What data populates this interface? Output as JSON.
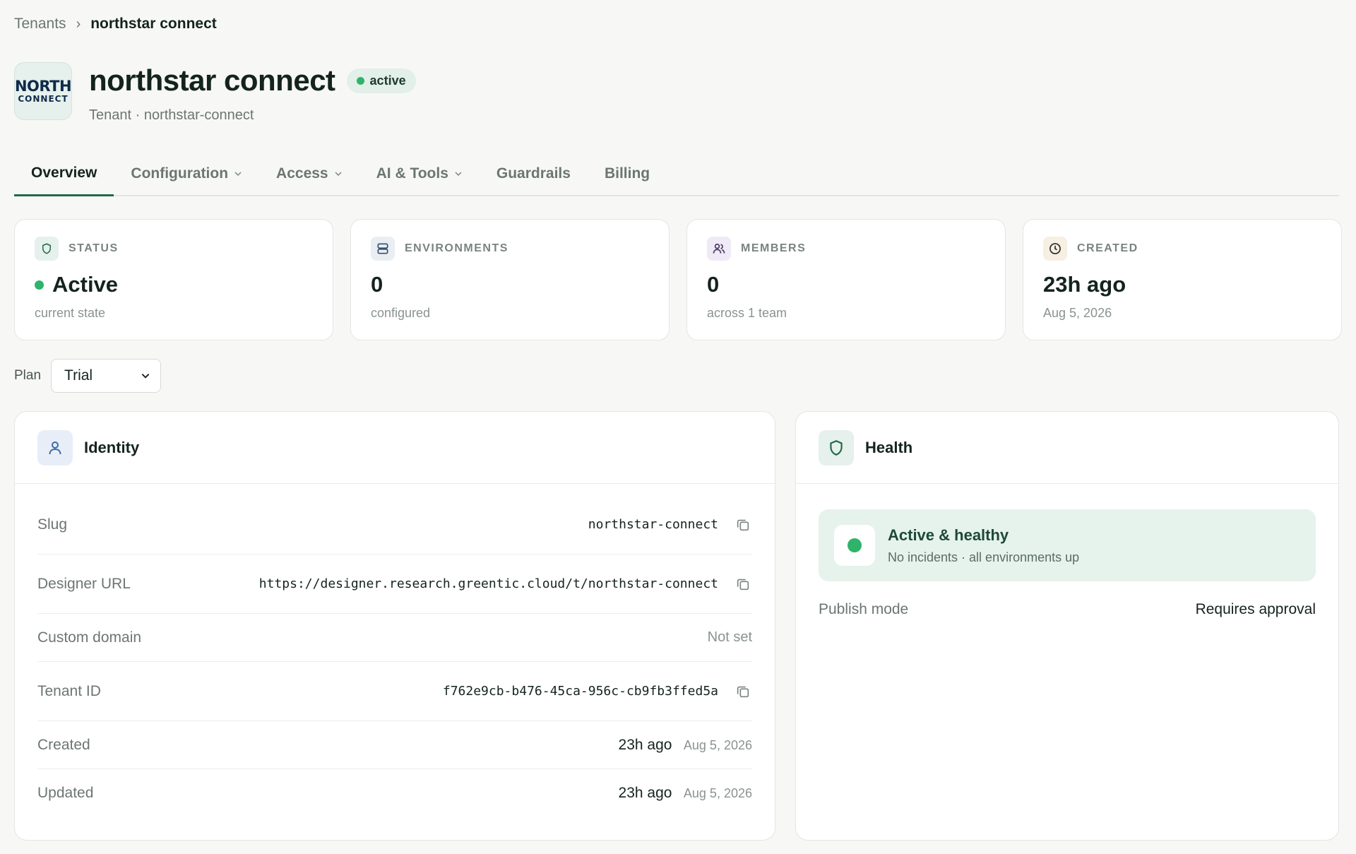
{
  "breadcrumb": {
    "root": "Tenants",
    "separator": "›",
    "current": "northstar connect"
  },
  "header": {
    "logo_line1": "NORTH",
    "logo_line2": "CONNECT",
    "title": "northstar connect",
    "status": "active",
    "subtitle": "Tenant · northstar-connect"
  },
  "tabs": [
    {
      "label": "Overview",
      "active": true
    },
    {
      "label": "Configuration"
    },
    {
      "label": "Access"
    },
    {
      "label": "AI & Tools"
    },
    {
      "label": "Guardrails"
    },
    {
      "label": "Billing"
    }
  ],
  "stats": {
    "status": {
      "label": "STATUS",
      "value": "Active",
      "sub": "current state"
    },
    "environments": {
      "label": "ENVIRONMENTS",
      "value": "0",
      "sub": "configured"
    },
    "members": {
      "label": "MEMBERS",
      "value": "0",
      "sub": "across 1 team"
    },
    "created": {
      "label": "CREATED",
      "value": "23h ago",
      "sub": "Aug 5, 2026"
    }
  },
  "plan": {
    "label": "Plan",
    "selected": "Trial"
  },
  "identity": {
    "title": "Identity",
    "rows": {
      "slug": {
        "label": "Slug",
        "value": "northstar-connect"
      },
      "designer_url": {
        "label": "Designer URL",
        "value": "https://designer.research.greentic.cloud/t/northstar-connect"
      },
      "custom_domain": {
        "label": "Custom domain",
        "value": "Not set"
      },
      "tenant_id": {
        "label": "Tenant ID",
        "value": "f762e9cb-b476-45ca-956c-cb9fb3ffed5a"
      },
      "created": {
        "label": "Created",
        "relative": "23h ago",
        "date": "Aug 5, 2026"
      },
      "updated": {
        "label": "Updated",
        "relative": "23h ago",
        "date": "Aug 5, 2026"
      }
    }
  },
  "health": {
    "title": "Health",
    "status_title": "Active & healthy",
    "status_sub": "No incidents · all environments up",
    "publish_label": "Publish mode",
    "publish_value": "Requires approval"
  },
  "colors": {
    "accent": "#1f6a47",
    "healthy": "#2fb36b",
    "background": "#f7f8f6"
  }
}
